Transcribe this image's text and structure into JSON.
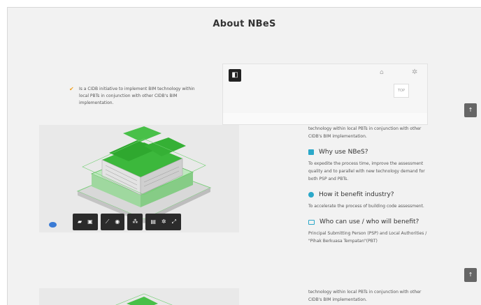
{
  "page": {
    "title": "About NBeS"
  },
  "intro": {
    "checklist": [
      "Is a CIDB initiative to implement BIM technology within local PBTs in conjunction with other CIDB's BIM implementation."
    ]
  },
  "viewer_panel": {
    "top_label": "TOP"
  },
  "toolbar": {
    "groups": [
      [
        "camera-icon",
        "fit-icon"
      ],
      [
        "measure-icon",
        "eye-icon"
      ],
      [
        "structure-icon"
      ],
      [
        "document-icon",
        "settings-icon",
        "fullscreen-icon"
      ]
    ]
  },
  "info": {
    "intro_text": "technology within local PBTs in conjunction with other CIDB's BIM implementation.",
    "sections": [
      {
        "title": "Why use NBeS?",
        "text": "To expedite the process time, improve the assessment quality and to parallel with new technology demand for both PSP and PBTs."
      },
      {
        "title": "How it benefit industry?",
        "text": "To accelerate the process of building code assessment."
      },
      {
        "title": "Who can use / who will benefit?",
        "text": "Principal Submitting Person (PSP) and Local Authorities / \"Pihak Berkuasa Tempatan\"(PBT)"
      }
    ],
    "bottom_text": "technology within local PBTs in conjunction with other CIDB's BIM implementation."
  },
  "scroll_top": {
    "label": "↑"
  },
  "colors": {
    "accent": "#2ba8c9",
    "check": "#f0a020",
    "building_green": "#3cb83c"
  }
}
